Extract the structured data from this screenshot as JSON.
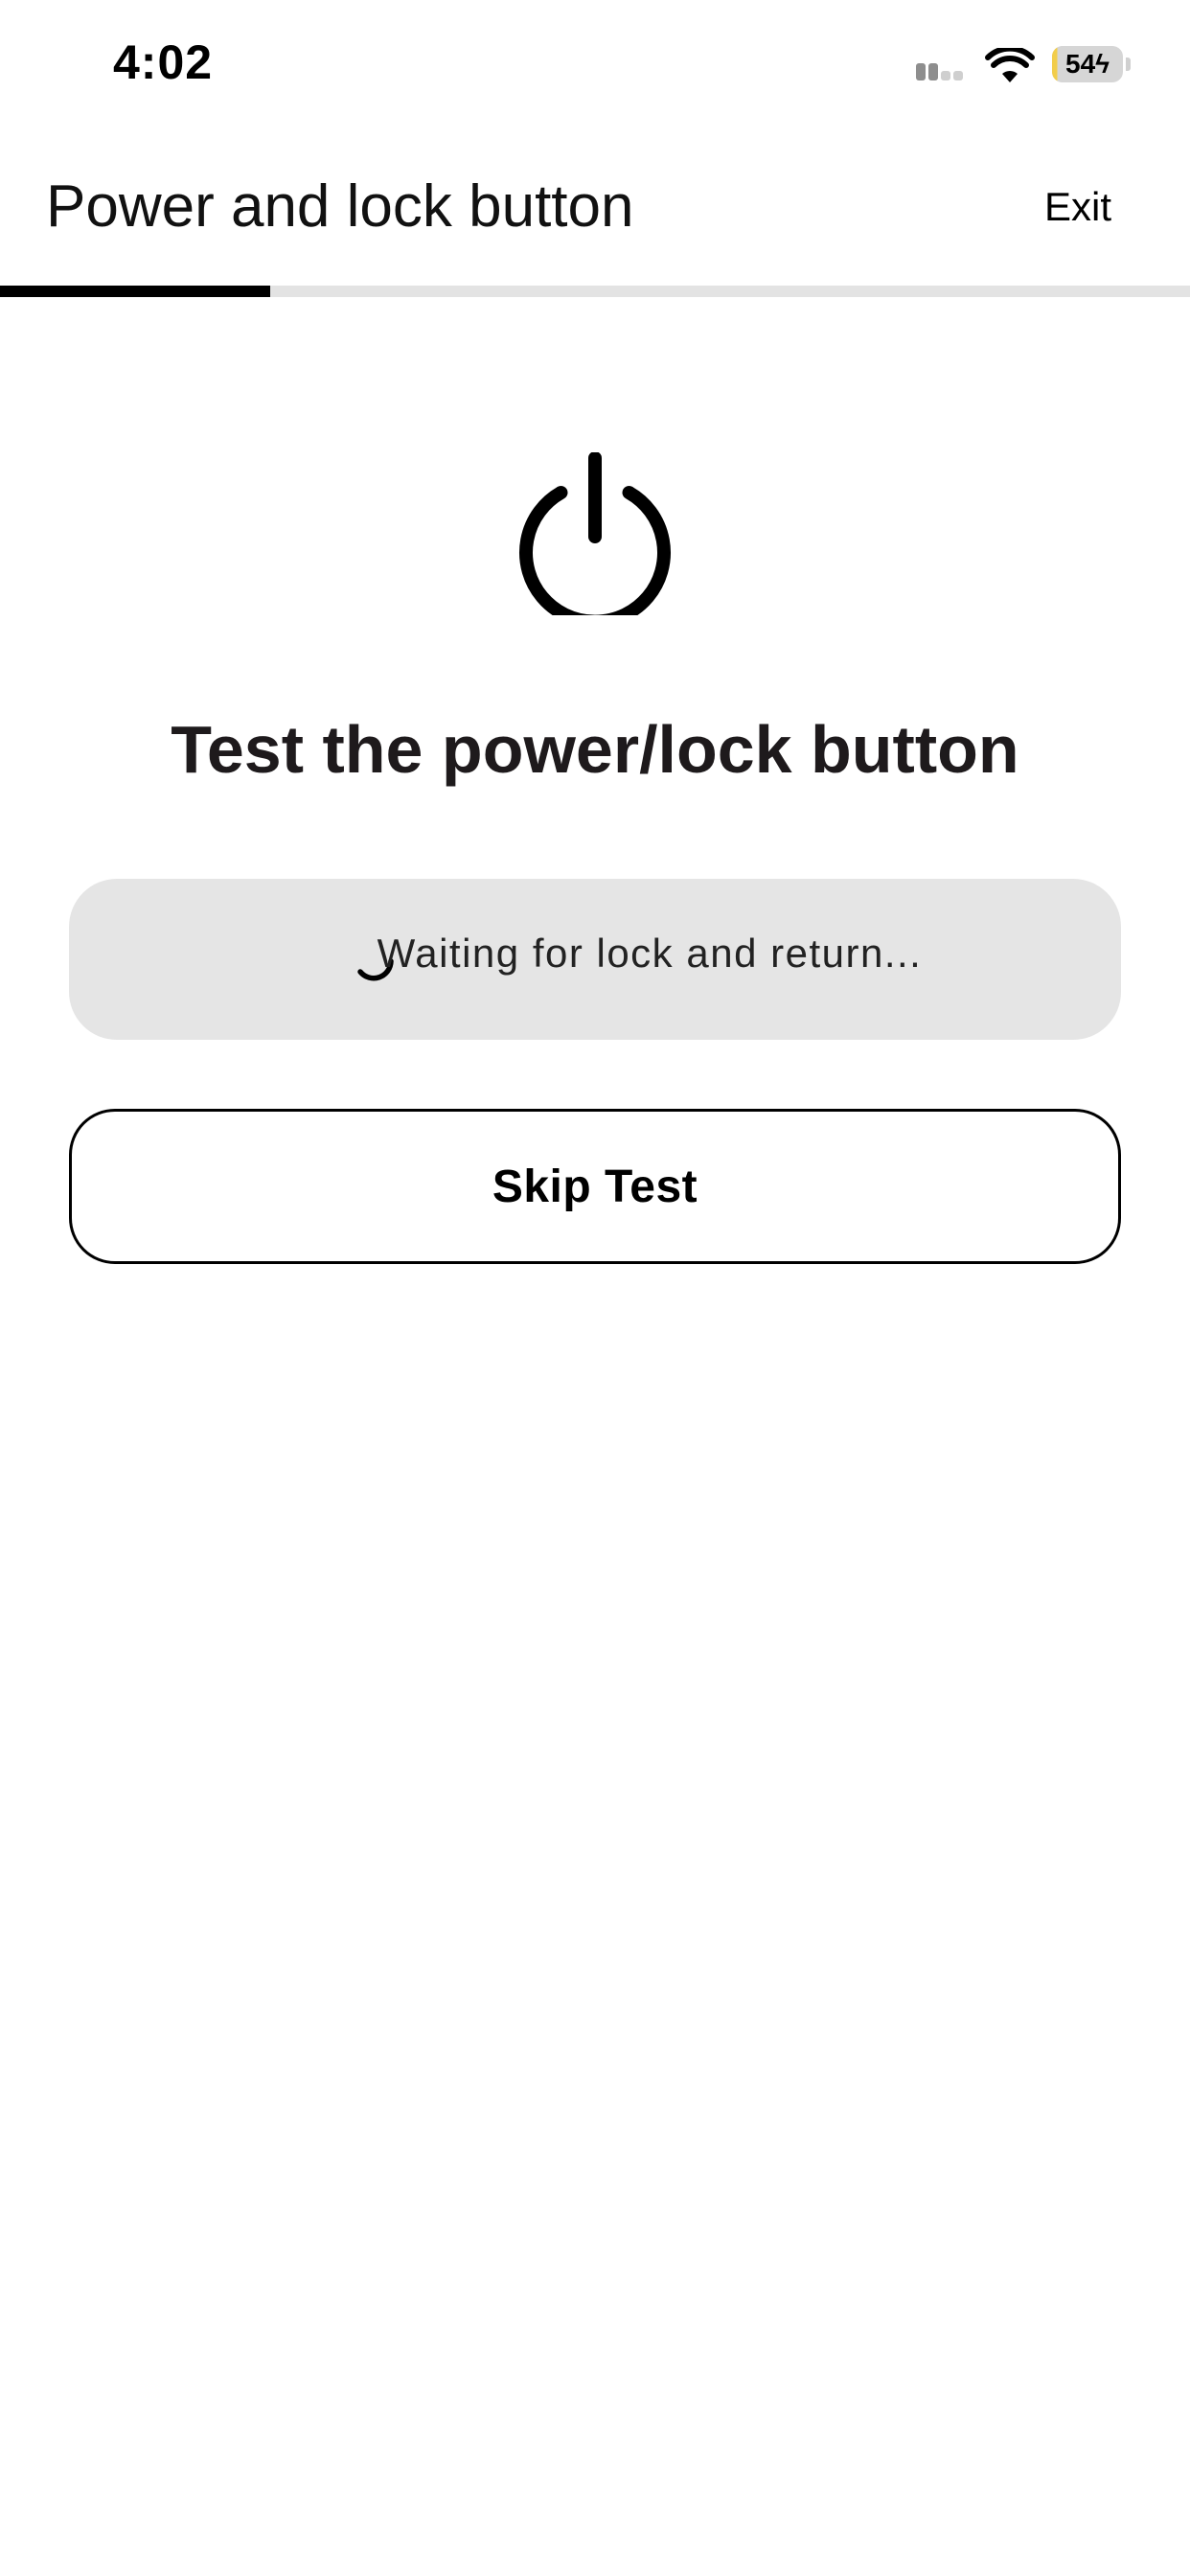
{
  "status_bar": {
    "time": "4:02",
    "battery_level": "54",
    "battery_fill_color": "#f2cd4a",
    "battery_charging": true
  },
  "header": {
    "title": "Power and lock button",
    "exit_label": "Exit"
  },
  "progress": {
    "fraction": 0.227,
    "fill_color": "#000000",
    "track_color": "#e3e3e3"
  },
  "main": {
    "icon": "power-icon",
    "heading": "Test the power/lock button",
    "status_text": "Waiting for lock and return...",
    "status_icon": "spinner-icon",
    "skip_label": "Skip Test"
  }
}
